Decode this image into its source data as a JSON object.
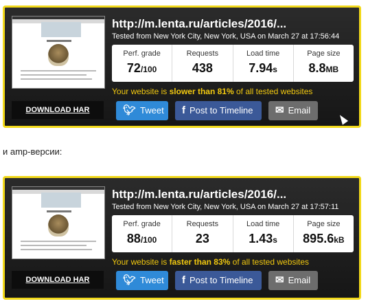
{
  "cards": [
    {
      "url": "http://m.lenta.ru/articles/2016/...",
      "tested": "Tested from New York City, New York, USA on March 27 at 17:56:44",
      "perf_label": "Perf. grade",
      "perf_value": "72",
      "perf_unit": "/100",
      "req_label": "Requests",
      "req_value": "438",
      "load_label": "Load time",
      "load_value": "7.94",
      "load_unit": "s",
      "size_label": "Page size",
      "size_value": "8.8",
      "size_unit": "MB",
      "cmp_pre": "Your website is ",
      "cmp_bold": "slower than 81%",
      "cmp_post": " of all tested websites",
      "download": "DOWNLOAD HAR",
      "tweet": "Tweet",
      "post": "Post to Timeline",
      "email": "Email"
    },
    {
      "url": "http://m.lenta.ru/articles/2016/...",
      "tested": "Tested from New York City, New York, USA on March 27 at 17:57:11",
      "perf_label": "Perf. grade",
      "perf_value": "88",
      "perf_unit": "/100",
      "req_label": "Requests",
      "req_value": "23",
      "load_label": "Load time",
      "load_value": "1.43",
      "load_unit": "s",
      "size_label": "Page size",
      "size_value": "895.6",
      "size_unit": "kB",
      "cmp_pre": "Your website is ",
      "cmp_bold": "faster than 83%",
      "cmp_post": " of all tested websites",
      "download": "DOWNLOAD HAR",
      "tweet": "Tweet",
      "post": "Post to Timeline",
      "email": "Email"
    }
  ],
  "caption": "и amp-версии:",
  "icons": {
    "twitter": "twitter-icon",
    "facebook": "facebook-icon",
    "email": "envelope-icon"
  },
  "colors": {
    "border": "#f2d91a",
    "highlight": "#f2c90f",
    "twitter": "#2f8ad8",
    "facebook": "#3b5998",
    "email": "#6d6d6d"
  }
}
